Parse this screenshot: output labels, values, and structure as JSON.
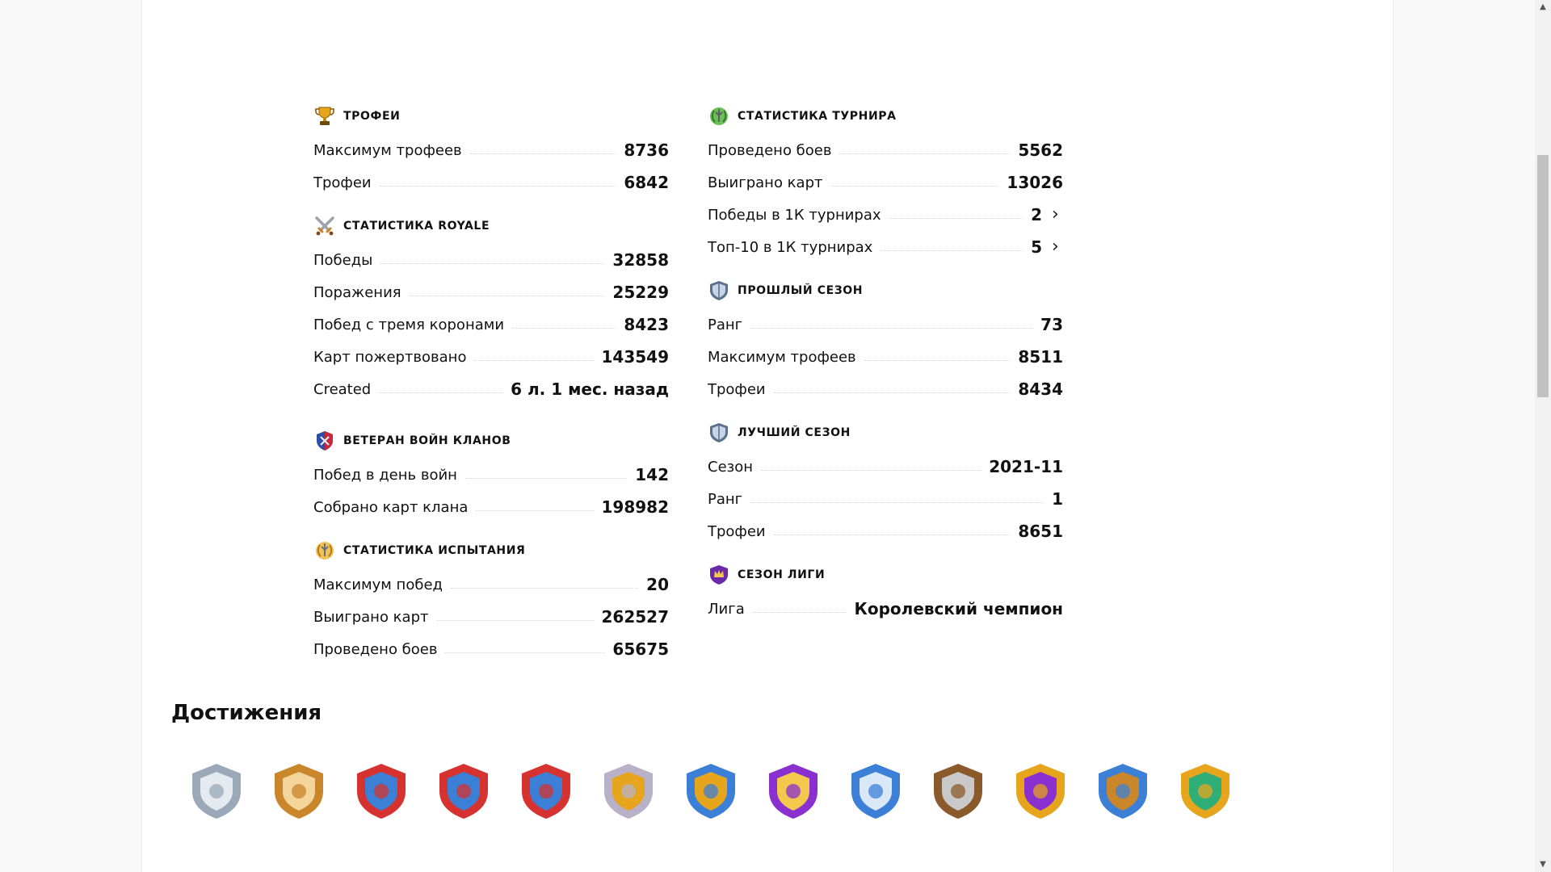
{
  "left_column": [
    {
      "title": "ТРОФЕИ",
      "icon": "trophy-icon",
      "rows": [
        {
          "label": "Максимум трофеев",
          "value": "8736"
        },
        {
          "label": "Трофеи",
          "value": "6842"
        }
      ]
    },
    {
      "title": "СТАТИСТИКА ROYALE",
      "icon": "crossed-swords-icon",
      "rows": [
        {
          "label": "Победы",
          "value": "32858"
        },
        {
          "label": "Поражения",
          "value": "25229"
        },
        {
          "label": "Побед с тремя коронами",
          "value": "8423"
        },
        {
          "label": "Карт пожертвовано",
          "value": "143549"
        },
        {
          "label": "Created",
          "value": "6 л. 1 мес. назад"
        }
      ]
    },
    {
      "title": "ВЕТЕРАН ВОЙН КЛАНОВ",
      "icon": "clan-war-shield-icon",
      "rows": [
        {
          "label": "Побед в день войн",
          "value": "142"
        },
        {
          "label": "Собрано карт клана",
          "value": "198982"
        }
      ]
    },
    {
      "title": "СТАТИСТИКА ИСПЫТАНИЯ",
      "icon": "challenge-laurel-icon",
      "rows": [
        {
          "label": "Максимум побед",
          "value": "20"
        },
        {
          "label": "Выиграно карт",
          "value": "262527"
        },
        {
          "label": "Проведено боев",
          "value": "65675"
        }
      ]
    }
  ],
  "right_column": [
    {
      "title": "СТАТИСТИКА ТУРНИРА",
      "icon": "tournament-laurel-icon",
      "rows": [
        {
          "label": "Проведено боев",
          "value": "5562"
        },
        {
          "label": "Выиграно карт",
          "value": "13026"
        },
        {
          "label": "Победы в 1К турнирах",
          "value": "2",
          "link": true
        },
        {
          "label": "Топ-10 в 1К турнирах",
          "value": "5",
          "link": true
        }
      ]
    },
    {
      "title": "ПРОШЛЫЙ СЕЗОН",
      "icon": "season-shield-icon",
      "rows": [
        {
          "label": "Ранг",
          "value": "73"
        },
        {
          "label": "Максимум трофеев",
          "value": "8511"
        },
        {
          "label": "Трофеи",
          "value": "8434"
        }
      ]
    },
    {
      "title": "ЛУЧШИЙ СЕЗОН",
      "icon": "season-shield-icon",
      "rows": [
        {
          "label": "Сезон",
          "value": "2021-11"
        },
        {
          "label": "Ранг",
          "value": "1"
        },
        {
          "label": "Трофеи",
          "value": "8651"
        }
      ]
    },
    {
      "title": "СЕЗОН ЛИГИ",
      "icon": "league-crown-icon",
      "rows": [
        {
          "label": "Лига",
          "value": "Королевский чемпион"
        }
      ]
    }
  ],
  "achievements": {
    "title": "Достижения",
    "badges": [
      {
        "icon": "silver-sword-badge-icon"
      },
      {
        "icon": "gold-sword-badge-icon"
      },
      {
        "icon": "year-2018-badge-icon"
      },
      {
        "icon": "year-2019-badge-icon"
      },
      {
        "icon": "year-2021-badge-icon"
      },
      {
        "icon": "gold-trophy-badge-icon"
      },
      {
        "icon": "blue-trophy-badge-icon"
      },
      {
        "icon": "purple-medal-badge-icon"
      },
      {
        "icon": "crown-shield-badge-icon"
      },
      {
        "icon": "crossed-swords-badge-icon"
      },
      {
        "icon": "purple-gem-badge-icon"
      },
      {
        "icon": "skull-badge-icon"
      },
      {
        "icon": "cards-badge-icon"
      }
    ]
  },
  "colors": {
    "gold": "#e6a51c",
    "blue": "#3b7fd6",
    "purple": "#8a2fd0",
    "red": "#d6322f",
    "silver": "#aeb6bf"
  }
}
